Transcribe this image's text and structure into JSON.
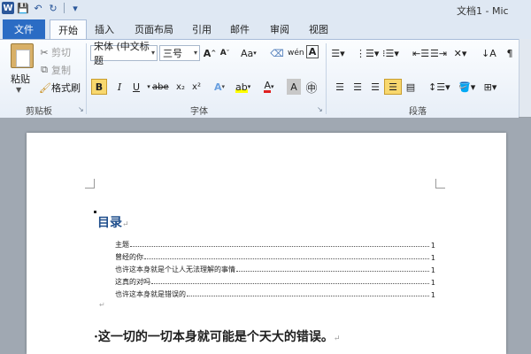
{
  "window": {
    "title": "文档1 - Mic"
  },
  "quick_access": {
    "app_icon": "W",
    "icons": [
      "save-icon",
      "undo-icon",
      "redo-icon",
      "customize-icon"
    ]
  },
  "tabs": {
    "file": "文件",
    "items": [
      "开始",
      "插入",
      "页面布局",
      "引用",
      "邮件",
      "审阅",
      "视图"
    ],
    "active": "开始"
  },
  "clipboard": {
    "paste": "粘贴",
    "cut": "剪切",
    "copy": "复制",
    "format_painter": "格式刷",
    "group_label": "剪贴板"
  },
  "font": {
    "name": "宋体 (中文标题",
    "size": "三号",
    "group_label": "字体",
    "grow": "A",
    "shrink": "A",
    "case": "Aa",
    "pinyin": "wén",
    "border_char": "A",
    "circle_char": "字",
    "bold": "B",
    "italic": "I",
    "underline": "U",
    "strike": "abe",
    "sub": "x₂",
    "sup": "x²",
    "effects": "A",
    "highlight": "ab",
    "color": "A",
    "shade": "A",
    "enclose": "㊥"
  },
  "paragraph": {
    "group_label": "段落"
  },
  "colors": {
    "accent": "#2b6cc4",
    "heading": "#1f4e8c",
    "font_color": "#e02020",
    "active_fill": "#f8d86e"
  },
  "document": {
    "toc_title": "目录",
    "toc_entries": [
      {
        "text": "主题",
        "page": "1"
      },
      {
        "text": "曾经的你",
        "page": "1"
      },
      {
        "text": "也许这本身就是个让人无法理解的事情",
        "page": "1"
      },
      {
        "text": "这真的对吗",
        "page": "1"
      },
      {
        "text": "也许这本身就是错误的",
        "page": "1"
      }
    ],
    "body_text": "这一切的一切本身就可能是个天大的错误。"
  }
}
